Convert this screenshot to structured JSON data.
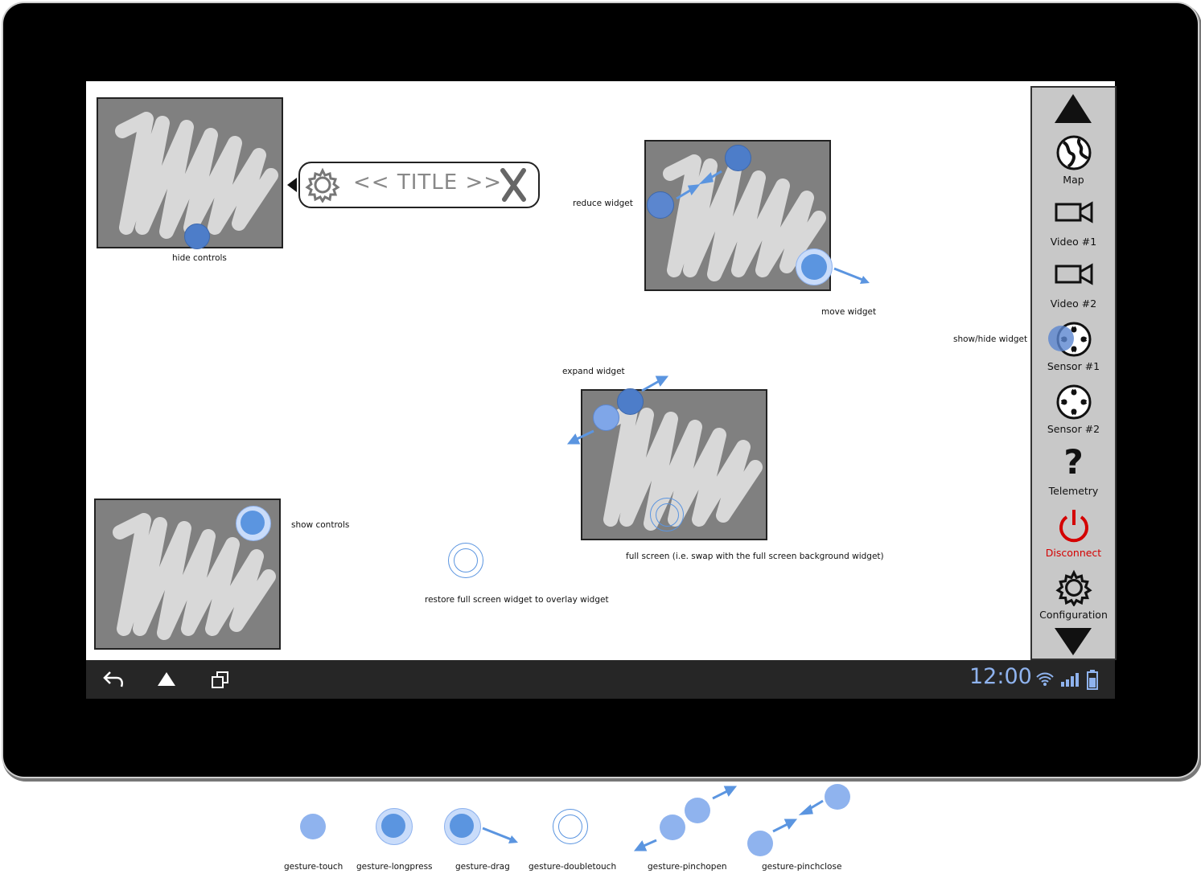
{
  "popup": {
    "title": "<< TITLE >>"
  },
  "annotations": {
    "hide_controls": "hide controls",
    "reduce_widget": "reduce widget",
    "move_widget": "move widget",
    "show_hide_widget": "show/hide widget",
    "expand_widget": "expand widget",
    "show_controls": "show controls",
    "full_screen": "full screen (i.e. swap with the full screen background widget)",
    "restore": "restore full screen widget to overlay widget"
  },
  "sidebar": {
    "items": [
      {
        "label": "Map",
        "icon": "globe-icon"
      },
      {
        "label": "Video #1",
        "icon": "video-camera-icon"
      },
      {
        "label": "Video #2",
        "icon": "video-camera-icon"
      },
      {
        "label": "Sensor #1",
        "icon": "sensor-icon"
      },
      {
        "label": "Sensor #2",
        "icon": "sensor-icon"
      },
      {
        "label": "Telemetry",
        "icon": "question-mark-icon"
      },
      {
        "label": "Disconnect",
        "icon": "power-icon",
        "color": "#d40000"
      },
      {
        "label": "Configuration",
        "icon": "gear-icon"
      }
    ]
  },
  "statusbar": {
    "time": "12:00",
    "accent": "#8fb3ee"
  },
  "legend": {
    "touch": "gesture-touch",
    "longpress": "gesture-longpress",
    "drag": "gesture-drag",
    "doubletouch": "gesture-doubletouch",
    "pinchopen": "gesture-pinchopen",
    "pinchclose": "gesture-pinchclose"
  }
}
